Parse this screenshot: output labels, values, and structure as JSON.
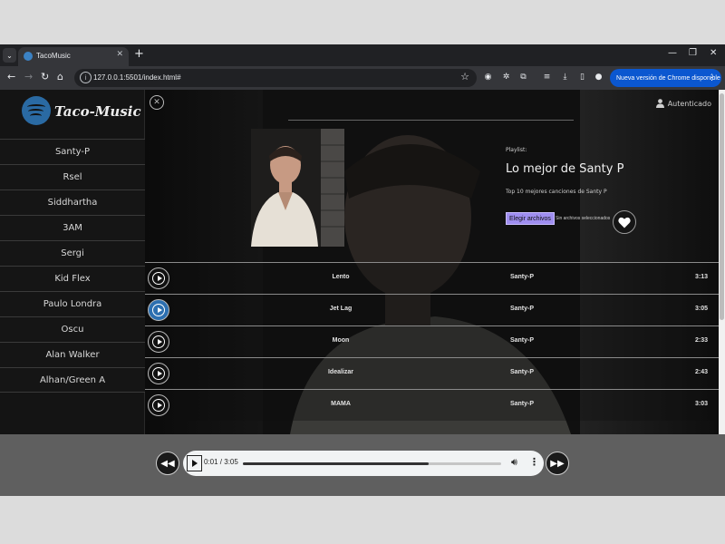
{
  "browser": {
    "tab_title": "TacoMusic",
    "url": "127.0.0.1:5501/index.html#",
    "update_label": "Nueva versión de Chrome disponible"
  },
  "app": {
    "brand": "Taco-Music",
    "auth_label": "Autenticado",
    "artists": [
      "Santy-P",
      "Rsel",
      "Siddhartha",
      "3AM",
      "Sergi",
      "Kid Flex",
      "Paulo Londra",
      "Oscu",
      "Alan Walker",
      "Alhan/Green A"
    ]
  },
  "playlist": {
    "label": "Playlist:",
    "title": "Lo mejor de Santy P",
    "description": "Top 10 mejores canciones de Santy P",
    "file_button": "Elegir archivos",
    "file_status": "Sin archivos seleccionados"
  },
  "tracks": [
    {
      "title": "Lento",
      "artist": "Santy-P",
      "duration": "3:13",
      "active": false
    },
    {
      "title": "Jet Lag",
      "artist": "Santy-P",
      "duration": "3:05",
      "active": true
    },
    {
      "title": "Moon",
      "artist": "Santy-P",
      "duration": "2:33",
      "active": false
    },
    {
      "title": "Idealizar",
      "artist": "Santy-P",
      "duration": "2:43",
      "active": false
    },
    {
      "title": "MAMA",
      "artist": "Santy-P",
      "duration": "3:03",
      "active": false
    }
  ],
  "player": {
    "time": "0:01 / 3:05",
    "progress_fraction": 0.72
  },
  "colors": {
    "accent_blue": "#2c6fb0",
    "file_button": "#9f8ef0",
    "chrome_update": "#0b57d0"
  }
}
